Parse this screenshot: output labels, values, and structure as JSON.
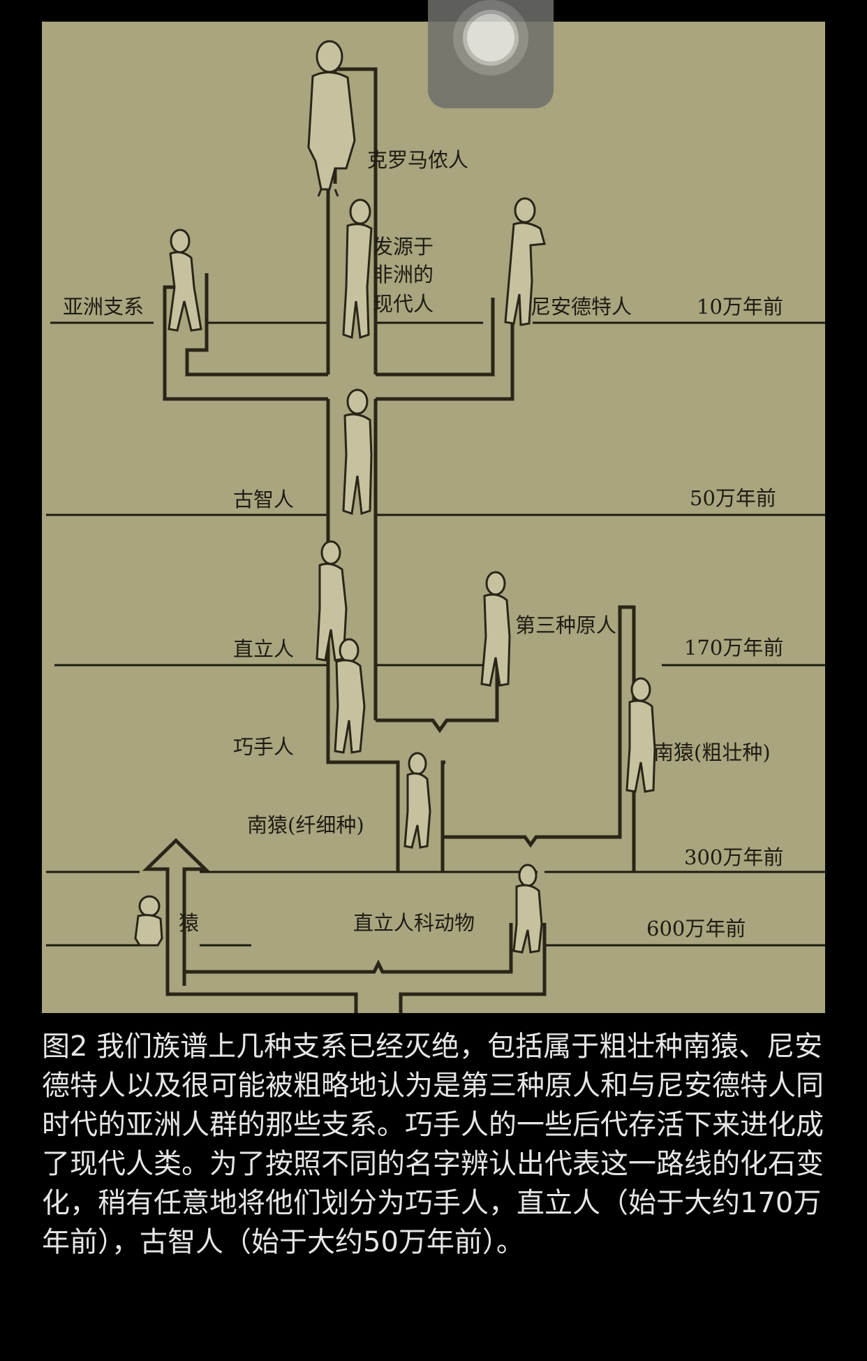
{
  "diagram": {
    "time_labels": [
      "10万年前",
      "50万年前",
      "170万年前",
      "300万年前",
      "600万年前"
    ],
    "species": {
      "cro_magnon": "克罗马侬人",
      "african_modern": [
        "发源于",
        "非洲的",
        "现代人"
      ],
      "asian_branch": "亚洲支系",
      "neanderthal": "尼安德特人",
      "archaic_sapiens": "古智人",
      "third_hominid": "第三种原人",
      "homo_erectus": "直立人",
      "homo_habilis": "巧手人",
      "robust_australopithecus": "南猿(粗壮种)",
      "gracile_australopithecus": "南猿(纤细种)",
      "ape": "猿",
      "hominid_family": "直立人科动物"
    }
  },
  "caption": "图2 我们族谱上几种支系已经灭绝，包括属于粗壮种南猿、尼安德特人以及很可能被粗略地认为是第三种原人和与尼安德特人同时代的亚洲人群的那些支系。巧手人的一些后代存活下来进化成了现代人类。为了按照不同的名字辨认出代表这一路线的化石变化，稍有任意地将他们划分为巧手人，直立人（始于大约170万年前），古智人（始于大约50万年前）。"
}
